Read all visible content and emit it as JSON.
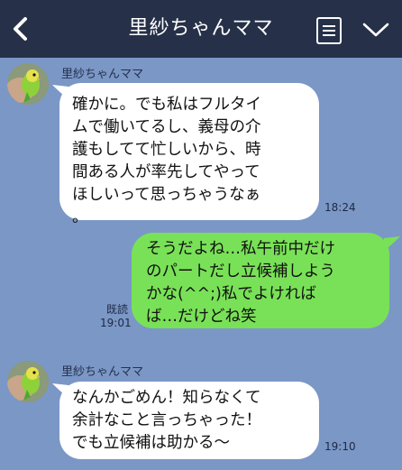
{
  "header": {
    "title": "里紗ちゃんママ",
    "back_icon": "chevron-left-icon",
    "menu_icon": "document-list-icon",
    "dropdown_icon": "chevron-down-icon"
  },
  "colors": {
    "header_bg": "#263149",
    "chat_bg": "#7b97c6",
    "incoming_bubble": "#ffffff",
    "outgoing_bubble": "#79e157"
  },
  "messages": [
    {
      "direction": "incoming",
      "sender": "里紗ちゃんママ",
      "text": "確かに。でも私はフルタイ\nムで働いてるし、義母の介\n護もしてて忙しいから、時\n間ある人が率先してやって\nほしいって思っちゃうなぁ\n。",
      "time": "18:24"
    },
    {
      "direction": "outgoing",
      "text": "そうだよね…私午前中だけ\nのパートだし立候補しよう\nかな(^^;)私でよければ\nば…だけどね笑",
      "read": "既読",
      "time": "19:01"
    },
    {
      "direction": "incoming",
      "sender": "里紗ちゃんママ",
      "text": "なんかごめん！知らなくて\n余計なこと言っちゃった！\nでも立候補は助かる〜",
      "time": "19:10"
    }
  ]
}
